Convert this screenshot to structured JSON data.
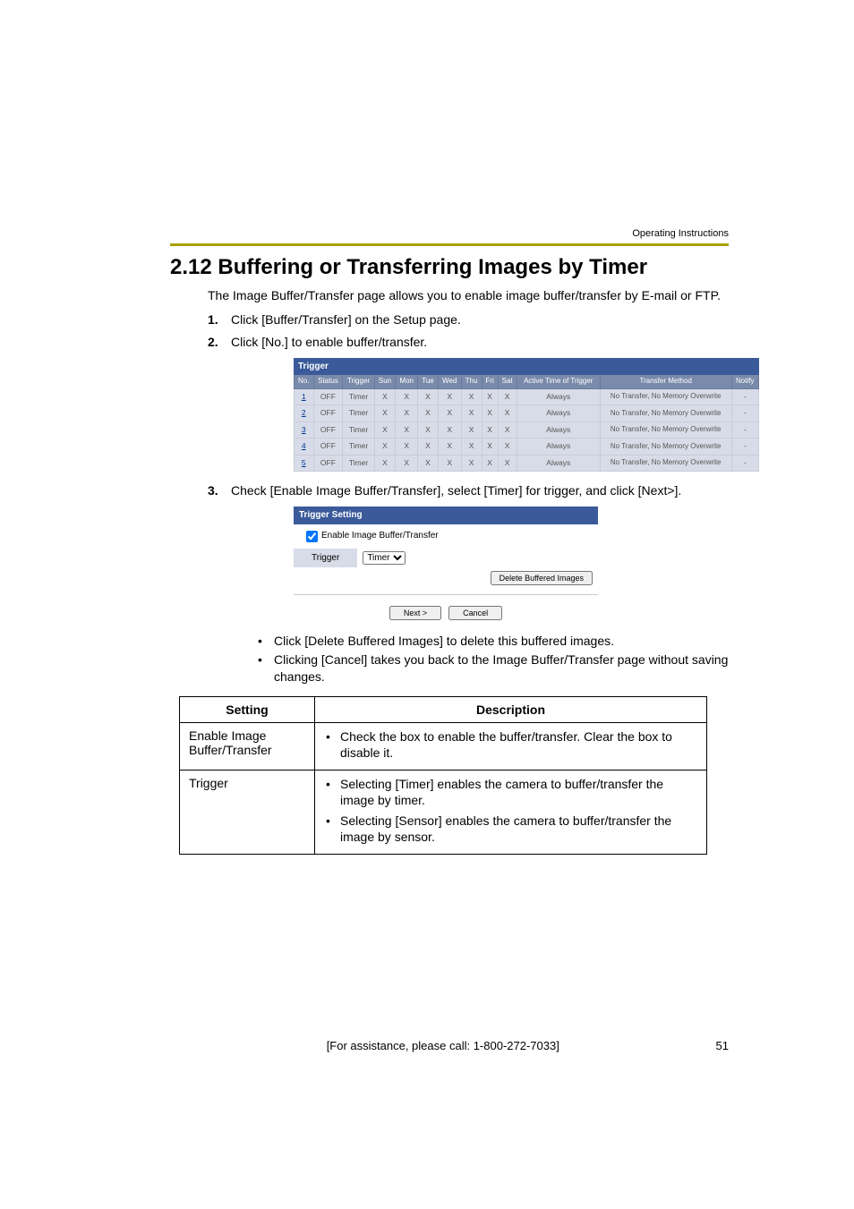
{
  "header": {
    "top_right": "Operating Instructions"
  },
  "title": "2.12  Buffering or Transferring Images by Timer",
  "intro": "The Image Buffer/Transfer page allows you to enable image buffer/transfer by E-mail or FTP.",
  "steps": [
    {
      "num": "1.",
      "text": "Click [Buffer/Transfer] on the Setup page."
    },
    {
      "num": "2.",
      "text": "Click [No.] to enable buffer/transfer."
    },
    {
      "num": "3.",
      "text": "Check [Enable Image Buffer/Transfer], select [Timer] for trigger, and click [Next>]."
    }
  ],
  "trigger_table": {
    "title": "Trigger",
    "headers": [
      "No.",
      "Status",
      "Trigger",
      "Sun",
      "Mon",
      "Tue",
      "Wed",
      "Thu",
      "Fri",
      "Sat",
      "Active Time of Trigger",
      "Transfer Method",
      "Notify"
    ],
    "rows": [
      {
        "no": "1",
        "status": "OFF",
        "trigger": "Timer",
        "days": [
          "X",
          "X",
          "X",
          "X",
          "X",
          "X",
          "X"
        ],
        "active": "Always",
        "method": "No Transfer, No Memory Overwrite",
        "notify": "-"
      },
      {
        "no": "2",
        "status": "OFF",
        "trigger": "Timer",
        "days": [
          "X",
          "X",
          "X",
          "X",
          "X",
          "X",
          "X"
        ],
        "active": "Always",
        "method": "No Transfer, No Memory Overwrite",
        "notify": "-"
      },
      {
        "no": "3",
        "status": "OFF",
        "trigger": "Timer",
        "days": [
          "X",
          "X",
          "X",
          "X",
          "X",
          "X",
          "X"
        ],
        "active": "Always",
        "method": "No Transfer, No Memory Overwrite",
        "notify": "-"
      },
      {
        "no": "4",
        "status": "OFF",
        "trigger": "Timer",
        "days": [
          "X",
          "X",
          "X",
          "X",
          "X",
          "X",
          "X"
        ],
        "active": "Always",
        "method": "No Transfer, No Memory Overwrite",
        "notify": "-"
      },
      {
        "no": "5",
        "status": "OFF",
        "trigger": "Timer",
        "days": [
          "X",
          "X",
          "X",
          "X",
          "X",
          "X",
          "X"
        ],
        "active": "Always",
        "method": "No Transfer, No Memory Overwrite",
        "notify": "-"
      }
    ]
  },
  "trigger_setting": {
    "title": "Trigger Setting",
    "checkbox_label": "Enable Image Buffer/Transfer",
    "trigger_label": "Trigger",
    "trigger_value": "Timer",
    "delete_btn": "Delete Buffered Images",
    "next_btn": "Next >",
    "cancel_btn": "Cancel"
  },
  "notes": [
    "Click [Delete Buffered Images] to delete this buffered images.",
    "Clicking [Cancel] takes you back to the Image Buffer/Transfer page without saving changes."
  ],
  "desc_table": {
    "head_setting": "Setting",
    "head_desc": "Description",
    "rows": [
      {
        "setting": "Enable Image Buffer/Transfer",
        "items": [
          "Check the box to enable the buffer/transfer. Clear the box to disable it."
        ]
      },
      {
        "setting": "Trigger",
        "items": [
          "Selecting [Timer] enables the camera to buffer/transfer the image by timer.",
          "Selecting [Sensor] enables the camera to buffer/transfer the image by sensor."
        ]
      }
    ]
  },
  "footer": {
    "text": "[For assistance, please call: 1-800-272-7033]",
    "page": "51"
  }
}
